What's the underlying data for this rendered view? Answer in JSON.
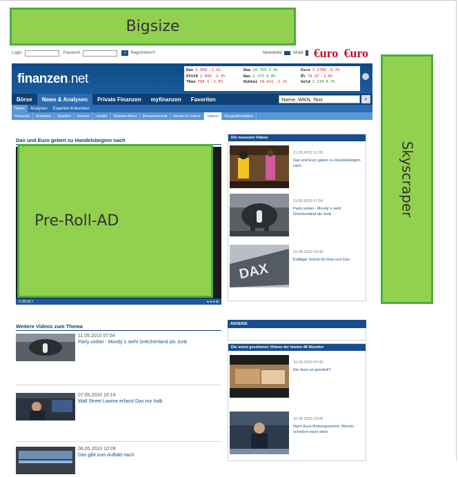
{
  "ads": {
    "bigsize": "Bigsize",
    "skyscraper": "Skyscraper",
    "preroll": "Pre-Roll-AD"
  },
  "loginbar": {
    "login_label": "Login",
    "password_label": "Passwort",
    "register_button": "»",
    "register_label": "Registrieren?",
    "newsletter_label": "Newsletter",
    "mobil_label": "Mobil",
    "euro_logo_1": "€uro",
    "euro_logo_2": "€uro"
  },
  "header": {
    "logo_main": "finanzen",
    "logo_dot": ".",
    "logo_net": "net"
  },
  "ticker": {
    "rows": [
      [
        {
          "name": "Dax",
          "value": "5.950",
          "change": "-1.1%",
          "dir": "down"
        },
        {
          "name": "Dow",
          "value": "10.765",
          "change": "3.9%",
          "dir": "up"
        },
        {
          "name": "Euro",
          "value": "1.2700",
          "change": "-0.7%",
          "dir": "down"
        }
      ],
      [
        {
          "name": "ESt50",
          "value": "2.695",
          "change": "-2.3%",
          "dir": "down"
        },
        {
          "name": "Nas",
          "value": "2.375",
          "change": "4.0%",
          "dir": "up"
        },
        {
          "name": "Öl",
          "value": "79.37",
          "change": "-1.6%",
          "dir": "down"
        }
      ],
      [
        {
          "name": "TDax",
          "value": "768.1",
          "change": "-1.5%",
          "dir": "down"
        },
        {
          "name": "Nikkei",
          "value": "10.411",
          "change": "-1.1%",
          "dir": "down"
        },
        {
          "name": "Gold",
          "value": "1.210",
          "change": "0.7%",
          "dir": "up"
        }
      ]
    ]
  },
  "mainnav": {
    "items": [
      "Börse",
      "News & Analysen",
      "Private Finanzen",
      "myfinanzen",
      "Favoriten"
    ],
    "active": 1,
    "search_value": "Name, WKN, Text"
  },
  "subnav1": {
    "items": [
      "News",
      "Analysen",
      "Experten-Kolumnen"
    ],
    "active": 0
  },
  "subnav2": {
    "items": [
      "Ressorts",
      "Rubriken",
      "Quellen",
      "Indizes",
      "Länder",
      "Researchtool",
      "Börsenchronik",
      "Heute im Fokus",
      "Videos",
      "Konjunkturdaten"
    ],
    "active": 8
  },
  "video": {
    "title": "Dax und Euro geben zu Handelsbeginn nach",
    "controls_left": "II  00:00 I",
    "controls_right": "◂ ◂    ◂ ◂)"
  },
  "newest": {
    "heading": "Die neuesten Videos",
    "items": [
      {
        "date": "11.05.2010 10:33",
        "text": "Dax und Euro geben zu Handelsbeginn nach"
      },
      {
        "date": "11.05.2010 07:54",
        "text": "Party vorbei - Moody´s sieht Griechenland als Junk"
      },
      {
        "date": "10.05.2010 16:40",
        "text": "Kräftiger Schub für Dow und Dax"
      }
    ]
  },
  "weitere": {
    "heading": "Weitere Videos zum Thema",
    "items": [
      {
        "date": "11.05.2010 07:54",
        "text": "Party vorbei - Moody´s sieht Griechenland als Junk"
      },
      {
        "date": "07.05.2010 10:14",
        "text": "Wall Street Lawine erfasst Dax nur halb"
      },
      {
        "date": "06.05.2010 10:09",
        "text": "Dax gibt zum Auftakt nach"
      }
    ]
  },
  "anzeige": {
    "label": "ANZEIGE"
  },
  "most_viewed": {
    "heading": "Die meist gesehenen Videos der letzten 48 Stunden",
    "items": [
      {
        "date": "10.05.2010 07:43",
        "text": "Der Euro ist gerettet!!!"
      },
      {
        "date": "10.05.2010 10:05",
        "text": "Nach Euro-Rettungsschirm: Börsen schießen nach oben"
      }
    ]
  }
}
